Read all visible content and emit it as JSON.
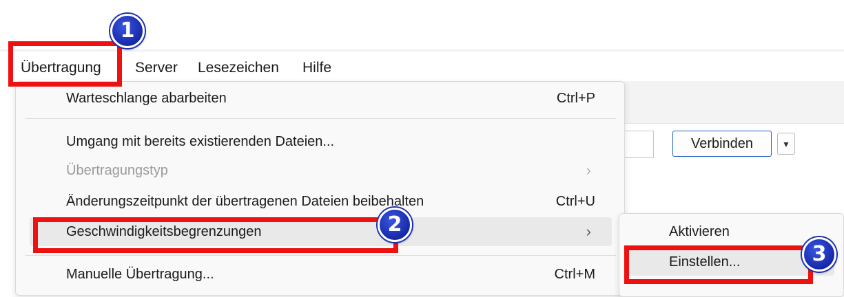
{
  "menubar": {
    "items": [
      {
        "label": "Übertragung"
      },
      {
        "label": "Server"
      },
      {
        "label": "Lesezeichen"
      },
      {
        "label": "Hilfe"
      }
    ]
  },
  "toolbar": {
    "connect_label": "Verbinden",
    "dropdown_icon": "▼"
  },
  "transfer_menu": {
    "items": [
      {
        "label": "Warteschlange abarbeiten",
        "accel": "Ctrl+P"
      },
      {
        "label": "Umgang mit bereits existierenden Dateien..."
      },
      {
        "label": "Übertragungstyp",
        "arrow": "›",
        "disabled": true
      },
      {
        "label": "Änderungszeitpunkt der übertragenen Dateien beibehalten",
        "accel": "Ctrl+U"
      },
      {
        "label": "Geschwindigkeitsbegrenzungen",
        "arrow": "›"
      },
      {
        "label": "Manuelle Übertragung...",
        "accel": "Ctrl+M"
      }
    ]
  },
  "speed_limit_submenu": {
    "items": [
      {
        "label": "Aktivieren"
      },
      {
        "label": "Einstellen..."
      }
    ]
  },
  "annotations": {
    "badges": [
      "1",
      "2",
      "3"
    ],
    "highlight_color": "#ee1111",
    "badge_color": "#1b2fb0"
  }
}
